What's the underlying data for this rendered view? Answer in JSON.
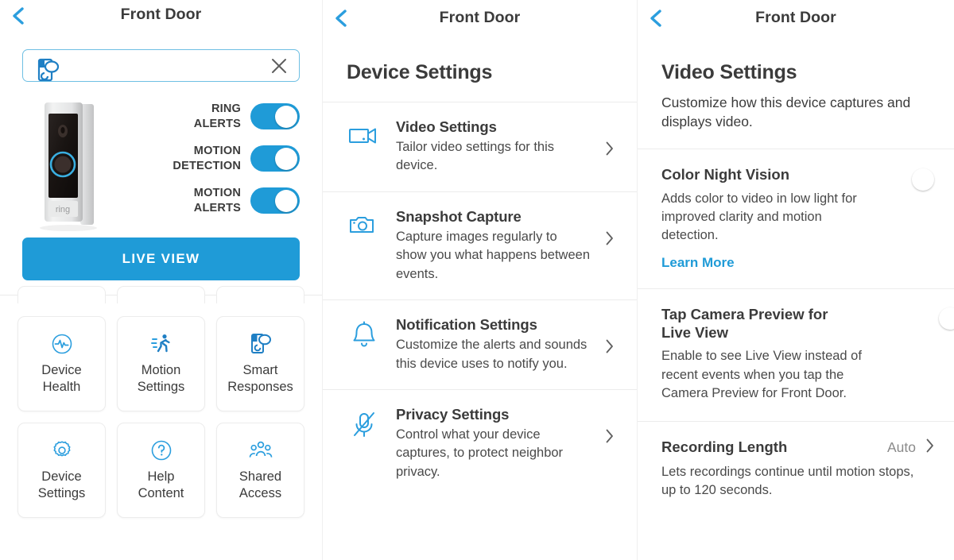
{
  "colors": {
    "accent": "#1f9bd7",
    "text": "#3b3b3b",
    "muted": "#8a8a8a",
    "toggle_off": "#e6e6e6"
  },
  "panel1": {
    "nav": {
      "title": "Front Door",
      "back_icon": "chevron-left-icon"
    },
    "search": {
      "value": "",
      "placeholder": "",
      "icon": "smart-responses-icon",
      "clear_icon": "close-icon"
    },
    "device": {
      "image_alt": "Ring Video Doorbell Pro",
      "brand": "ring"
    },
    "toggles": [
      {
        "label": "RING\nALERTS",
        "state": "on"
      },
      {
        "label": "MOTION\nDETECTION",
        "state": "on"
      },
      {
        "label": "MOTION\nALERTS",
        "state": "on"
      }
    ],
    "live_view_button": "LIVE VIEW",
    "tiles": [
      {
        "label": "Device\nHealth",
        "icon": "pulse-icon"
      },
      {
        "label": "Motion\nSettings",
        "icon": "running-person-icon"
      },
      {
        "label": "Smart\nResponses",
        "icon": "smart-responses-icon"
      },
      {
        "label": "Device\nSettings",
        "icon": "gear-icon"
      },
      {
        "label": "Help\nContent",
        "icon": "question-circle-icon"
      },
      {
        "label": "Shared\nAccess",
        "icon": "people-group-icon"
      }
    ]
  },
  "panel2": {
    "nav": {
      "title": "Front Door",
      "back_icon": "chevron-left-icon"
    },
    "heading": "Device Settings",
    "items": [
      {
        "title": "Video Settings",
        "desc": "Tailor video settings for this device.",
        "icon": "video-camera-icon",
        "chevron": "chevron-right-icon"
      },
      {
        "title": "Snapshot Capture",
        "desc": "Capture images regularly to show you what happens between events.",
        "icon": "camera-icon",
        "chevron": "chevron-right-icon"
      },
      {
        "title": "Notification Settings",
        "desc": "Customize the alerts and sounds this device uses to notify you.",
        "icon": "bell-icon",
        "chevron": "chevron-right-icon"
      },
      {
        "title": "Privacy Settings",
        "desc": "Control what your device captures, to protect neighbor privacy.",
        "icon": "microphone-muted-icon",
        "chevron": "chevron-right-icon"
      }
    ]
  },
  "panel3": {
    "nav": {
      "title": "Front Door",
      "back_icon": "chevron-left-icon"
    },
    "heading": "Video Settings",
    "subheading": "Customize how this device captures and displays video.",
    "items": [
      {
        "title": "Color Night Vision",
        "desc": "Adds color to video in low light for improved clarity and motion detection.",
        "link": "Learn More",
        "control": "toggle",
        "state": "on"
      },
      {
        "title": "Tap Camera Preview for Live View",
        "desc": "Enable to see Live View instead of recent events when you tap the Camera Preview for Front Door.",
        "control": "toggle",
        "state": "off"
      },
      {
        "title": "Recording Length",
        "desc": "Lets recordings continue until motion stops, up to 120 seconds.",
        "control": "value",
        "value": "Auto",
        "chevron": "chevron-right-icon"
      }
    ]
  }
}
